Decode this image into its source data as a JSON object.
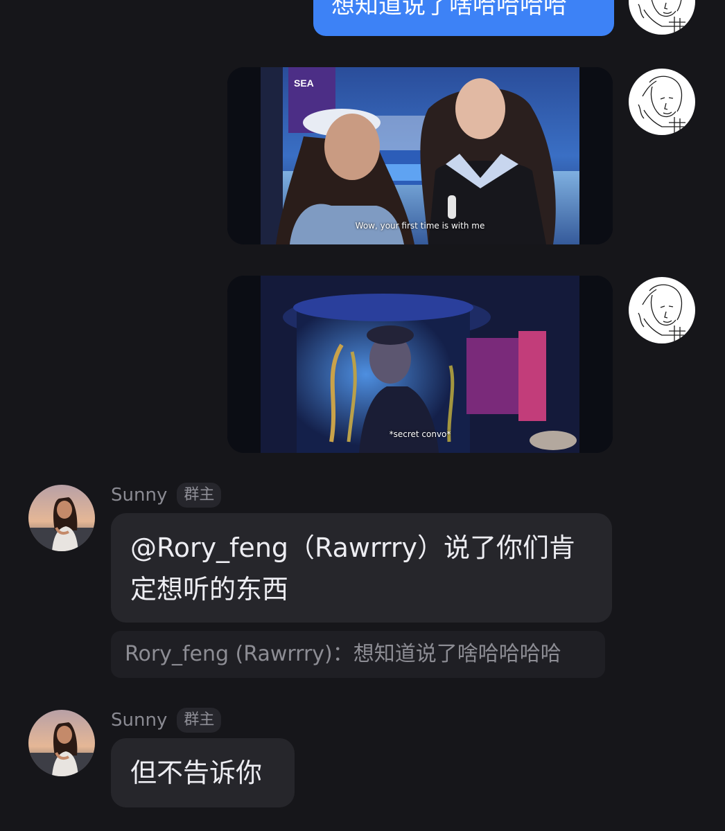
{
  "messages": {
    "outgoing_text": "想知道说了啥哈哈哈哈",
    "video_1": {
      "subtitle": "Wow, your first time is with me",
      "sign": "SEA"
    },
    "video_2": {
      "subtitle": "*secret convo*"
    },
    "incoming_1": {
      "sender": "Sunny",
      "badge": "群主",
      "line1": "@Rory_feng（Rawrrry）说了你们肯",
      "line2": "定想听的东西",
      "quote": "Rory_feng (Rawrrry)：想知道说了啥哈哈哈哈"
    },
    "incoming_2": {
      "sender": "Sunny",
      "badge": "群主",
      "text": "但不告诉你"
    }
  },
  "colors": {
    "background": "#16161a",
    "outgoing_bubble": "#3d82f6",
    "incoming_bubble": "#26262b",
    "badge_bg": "#26262c",
    "quote_bg": "#1f1f24"
  },
  "icons": {
    "self_avatar": "sketch-portrait-avatar",
    "sender_avatar": "photo-portrait-avatar"
  }
}
